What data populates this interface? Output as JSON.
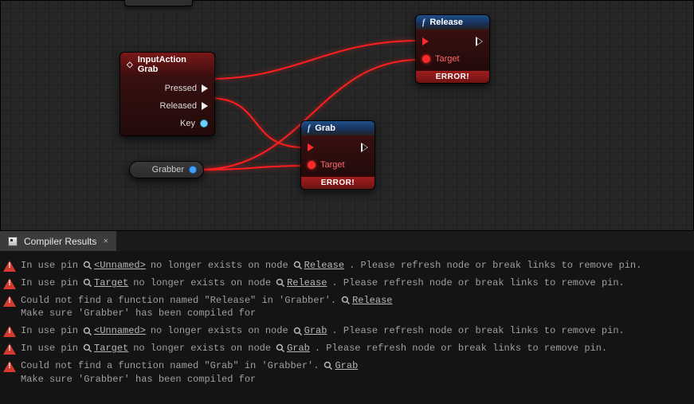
{
  "nodes": {
    "input": {
      "title": "InputAction Grab",
      "pins": {
        "pressed": "Pressed",
        "released": "Released",
        "key": "Key"
      }
    },
    "release": {
      "title": "Release",
      "target": "Target",
      "error": "ERROR!"
    },
    "grab": {
      "title": "Grab",
      "target": "Target",
      "error": "ERROR!"
    },
    "grabber": {
      "label": "Grabber"
    }
  },
  "panel": {
    "tab_title": "Compiler Results",
    "tab_close": "×"
  },
  "msgs": [
    {
      "type": "pin",
      "pre": "In use pin",
      "pin": "<Unnamed>",
      "mid": " no longer exists on node",
      "node": "Release",
      "post": ". Please refresh node or break links to remove pin."
    },
    {
      "type": "pin",
      "pre": "In use pin",
      "pin": "Target",
      "mid": " no longer exists on node",
      "node": "Release",
      "post": ". Please refresh node or break links to remove pin."
    },
    {
      "type": "fn",
      "line1": "Could not find a function named \"Release\" in 'Grabber'.",
      "line2": "Make sure 'Grabber' has been compiled for",
      "node": "Release"
    },
    {
      "type": "pin",
      "pre": "In use pin",
      "pin": "<Unnamed>",
      "mid": " no longer exists on node",
      "node": "Grab",
      "post": ". Please refresh node or break links to remove pin."
    },
    {
      "type": "pin",
      "pre": "In use pin",
      "pin": "Target",
      "mid": " no longer exists on node",
      "node": "Grab",
      "post": ". Please refresh node or break links to remove pin."
    },
    {
      "type": "fn",
      "line1": "Could not find a function named \"Grab\" in 'Grabber'.",
      "line2": "Make sure 'Grabber' has been compiled for",
      "node": "Grab"
    }
  ]
}
